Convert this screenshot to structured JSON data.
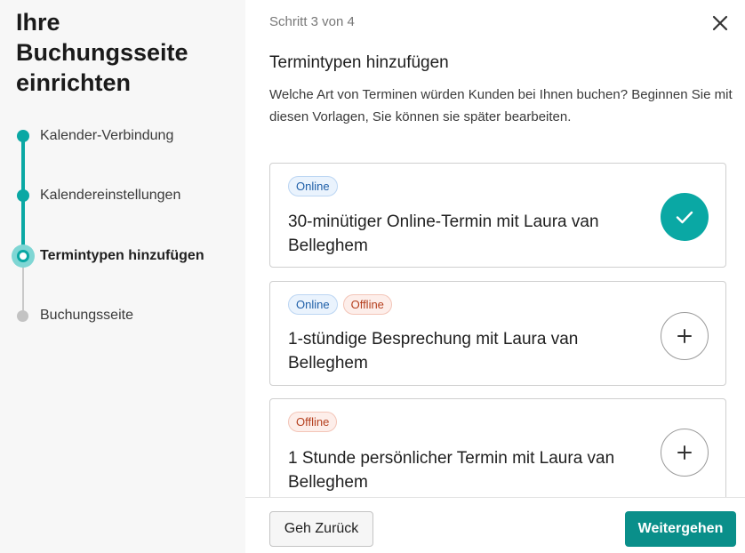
{
  "sidebar": {
    "title": "Ihre Buchungsseite einrichten",
    "steps": [
      {
        "label": "Kalender-Verbindung",
        "state": "done"
      },
      {
        "label": "Kalendereinstellungen",
        "state": "done"
      },
      {
        "label": "Termintypen hinzufügen",
        "state": "current"
      },
      {
        "label": "Buchungsseite",
        "state": "todo"
      }
    ]
  },
  "main": {
    "step_counter": "Schritt 3 von 4",
    "heading": "Termintypen hinzufügen",
    "description": "Welche Art von Terminen würden Kunden bei Ihnen buchen? Beginnen Sie mit diesen Vorlagen, Sie können sie später bearbeiten.",
    "cards": [
      {
        "tags": [
          "Online"
        ],
        "title": "30-minütiger Online-Termin mit Laura van Belleghem",
        "selected": true
      },
      {
        "tags": [
          "Online",
          "Offline"
        ],
        "title": "1-stündige Besprechung mit Laura van Belleghem",
        "selected": false
      },
      {
        "tags": [
          "Offline"
        ],
        "title": "1 Stunde persönlicher Termin mit Laura van Belleghem",
        "selected": false
      }
    ]
  },
  "footer": {
    "back_label": "Geh Zurück",
    "next_label": "Weitergehen"
  },
  "colors": {
    "accent": "#0aa8a4",
    "primary_button": "#0a8f8a",
    "online_tag": "#1f5fa8",
    "offline_tag": "#b5401f"
  },
  "icons": {
    "close": "close-icon",
    "selected": "checkmark-icon",
    "add": "plus-icon"
  }
}
